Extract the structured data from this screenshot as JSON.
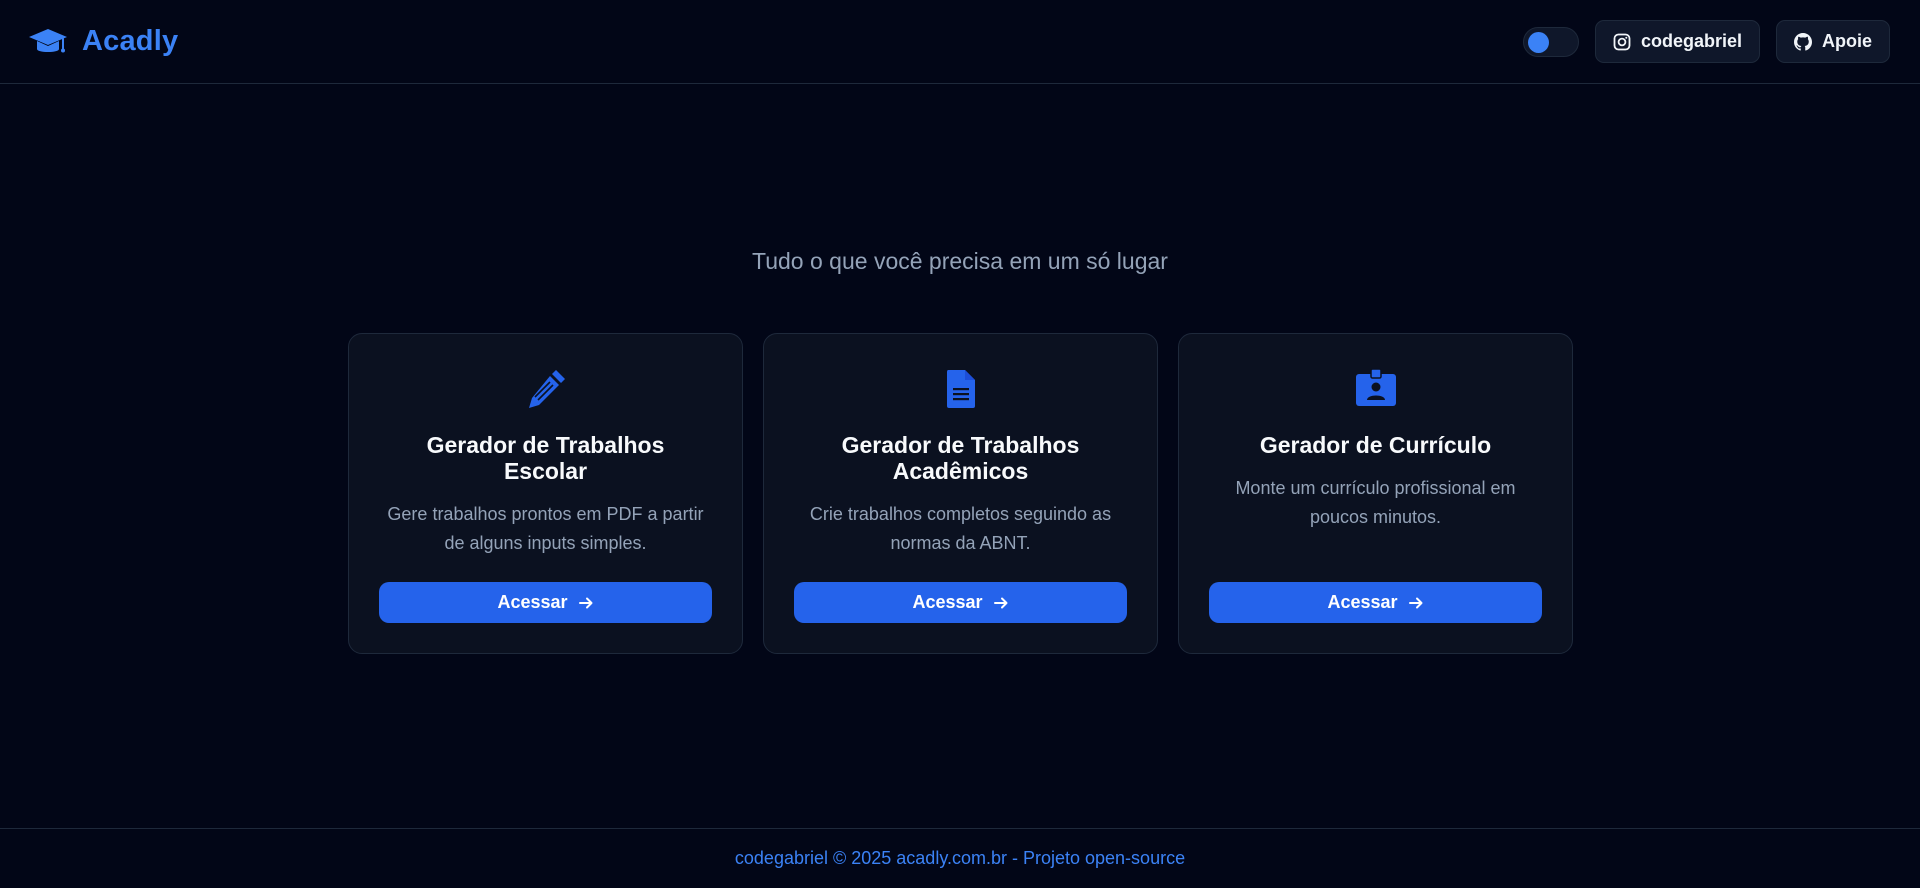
{
  "brand": {
    "name": "Acadly",
    "icon": "graduation-cap-icon",
    "color": "#3b82f6"
  },
  "header": {
    "theme_toggle": {
      "state": "dark"
    },
    "instagram": {
      "label": "codegabriel",
      "icon": "instagram-icon"
    },
    "github": {
      "label": "Apoie",
      "icon": "github-icon"
    }
  },
  "main": {
    "tagline": "Tudo o que você precisa em um só lugar",
    "cards": [
      {
        "icon": "pencil-icon",
        "title": "Gerador de Trabalhos Escolar",
        "description": "Gere trabalhos prontos em PDF a partir de alguns inputs simples.",
        "button": "Acessar"
      },
      {
        "icon": "document-icon",
        "title": "Gerador de Trabalhos Acadêmicos",
        "description": "Crie trabalhos completos seguindo as normas da ABNT.",
        "button": "Acessar"
      },
      {
        "icon": "id-badge-icon",
        "title": "Gerador de Currículo",
        "description": "Monte um currículo profissional em poucos minutos.",
        "button": "Acessar"
      }
    ]
  },
  "footer": {
    "text": "codegabriel © 2025 acadly.com.br - Projeto open-source"
  },
  "colors": {
    "background": "#020617",
    "accent": "#2563eb",
    "card": "#0b1120",
    "border": "#1e293b"
  }
}
